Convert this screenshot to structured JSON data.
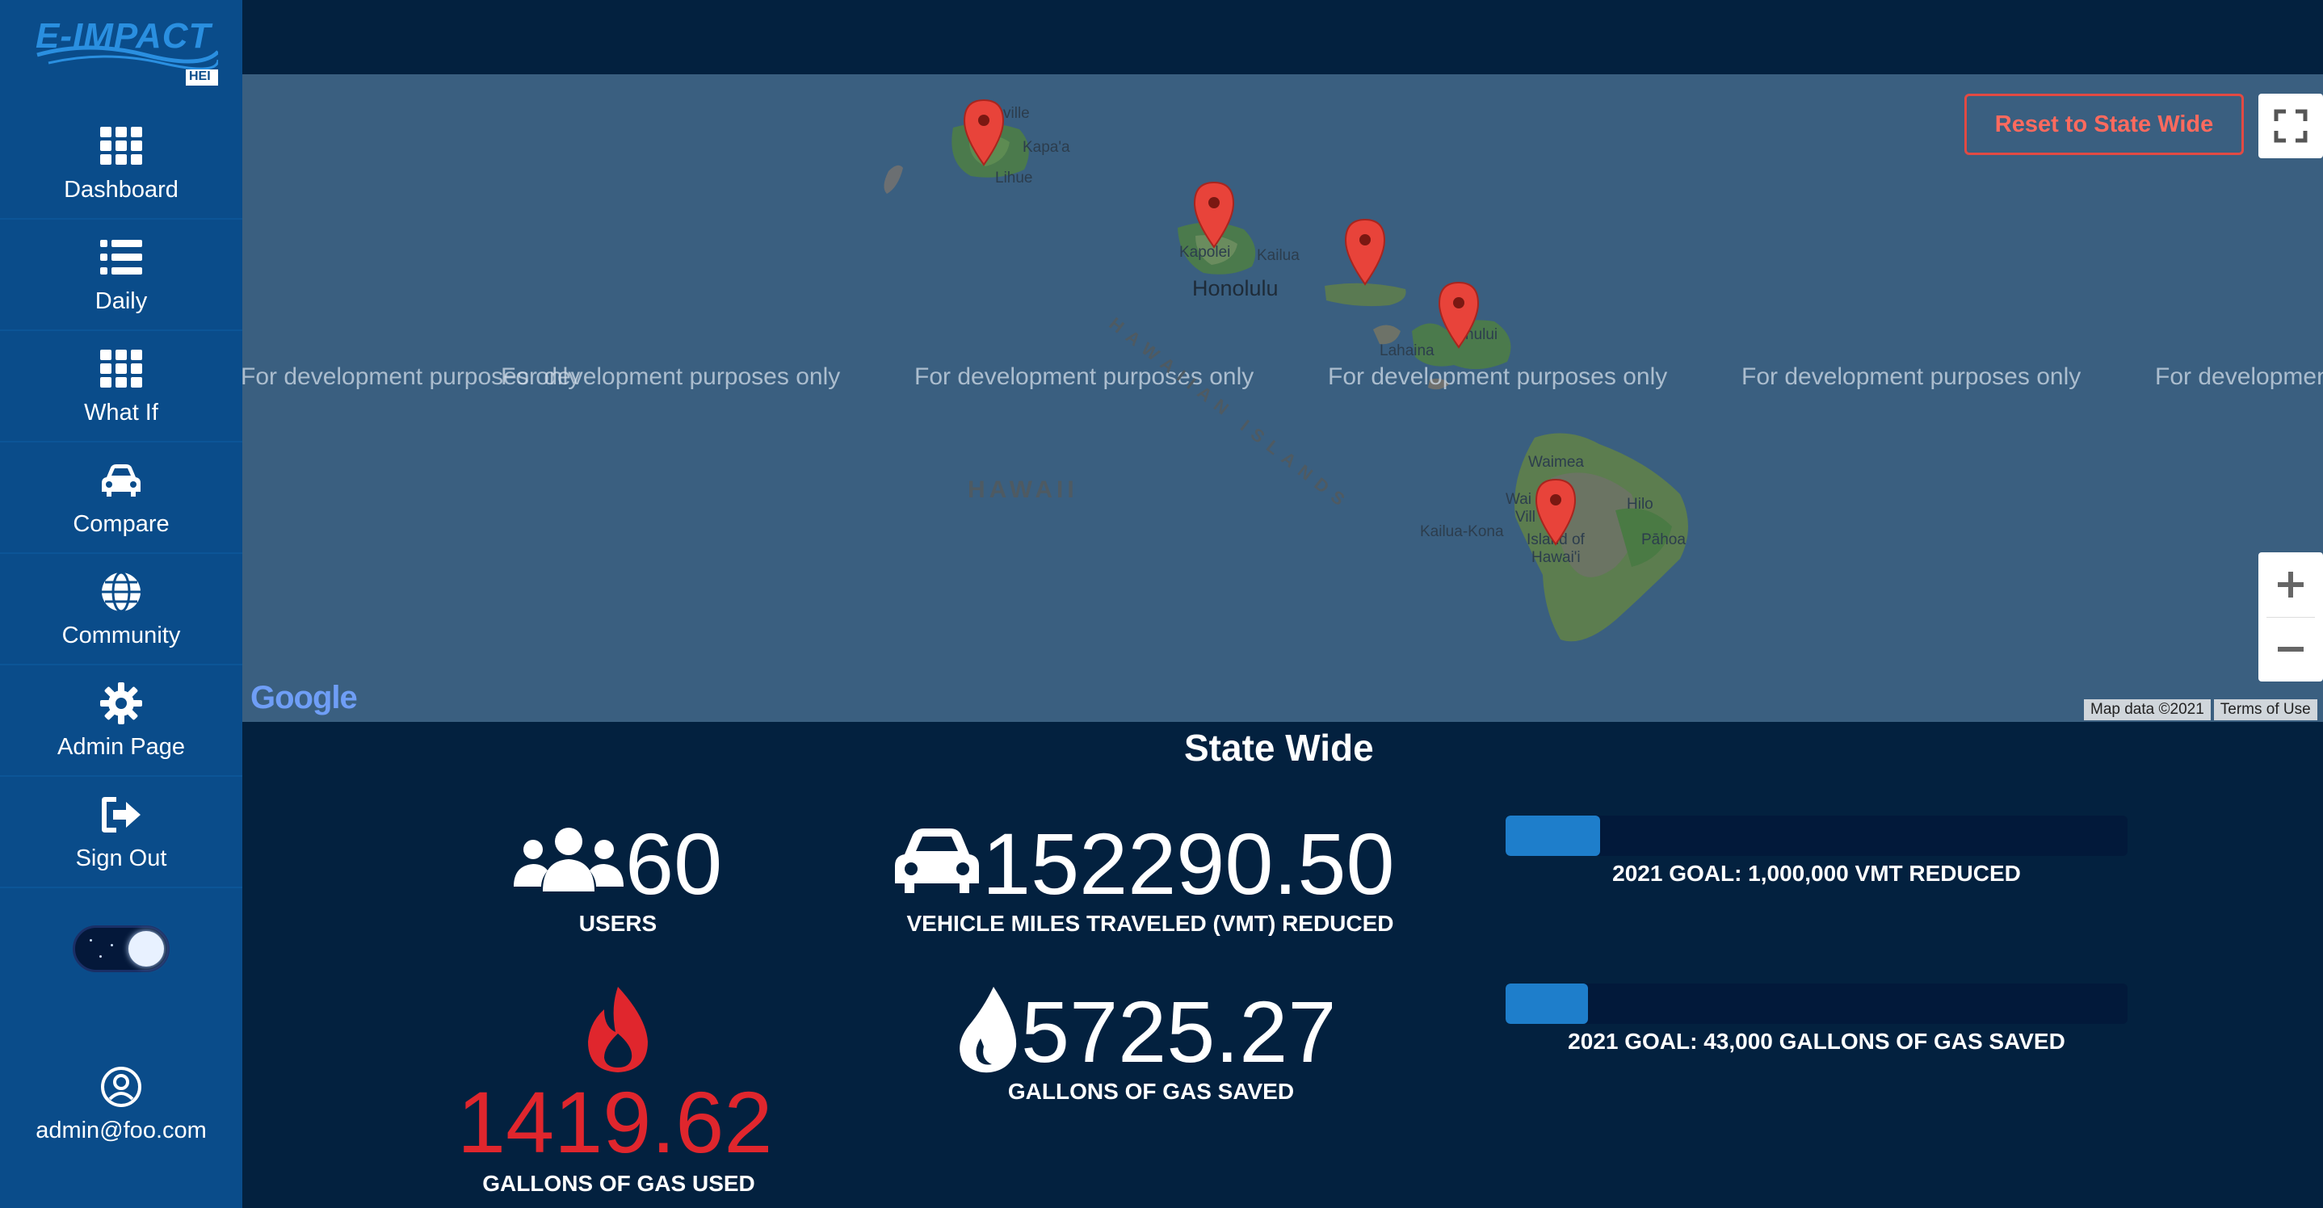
{
  "app": {
    "logo_text": "E-IMPACT",
    "logo_sub": "HEI"
  },
  "sidebar": {
    "items": [
      {
        "label": "Dashboard",
        "icon": "grid-icon"
      },
      {
        "label": "Daily",
        "icon": "list-icon"
      },
      {
        "label": "What If",
        "icon": "grid-icon"
      },
      {
        "label": "Compare",
        "icon": "car-icon"
      },
      {
        "label": "Community",
        "icon": "globe-icon"
      },
      {
        "label": "Admin Page",
        "icon": "gear-icon"
      },
      {
        "label": "Sign Out",
        "icon": "sign-out-icon"
      }
    ],
    "theme_toggle": "dark-mode",
    "user_email": "admin@foo.com"
  },
  "map": {
    "reset_button": "Reset to State Wide",
    "watermark": "For development purposes only",
    "region_labels": [
      "HAWAII",
      "HAWAIIAN ISLANDS"
    ],
    "place_labels": {
      "wailua": "ville",
      "kapaa": "Kapa'a",
      "lihue": "Lihue",
      "kapolei": "Kapolei",
      "kailua": "Kailua",
      "honolulu": "Honolulu",
      "kahului": "hului",
      "lahaina": "Lahaina",
      "waimea": "Waimea",
      "waikoloa": "Wai",
      "village": "Vill",
      "kona": "Kailua-Kona",
      "hilo": "Hilo",
      "pahoa": "Pāhoa",
      "island_hawaii": "Island of",
      "island_hawaii2": "Hawai'i"
    },
    "attribution": "Map data ©2021",
    "terms": "Terms of Use",
    "google": "Google",
    "pin_color": "#e8433a"
  },
  "stats": {
    "title": "State Wide",
    "users": {
      "value": "60",
      "label": "USERS"
    },
    "vmt": {
      "value": "152290.50",
      "label": "VEHICLE MILES TRAVELED (VMT) REDUCED"
    },
    "gas_used": {
      "value": "1419.62",
      "label": "GALLONS OF GAS USED",
      "color": "#e0262d"
    },
    "gas_saved": {
      "value": "5725.27",
      "label": "GALLONS OF GAS SAVED"
    },
    "goals": [
      {
        "label": "2021 GOAL: 1,000,000 VMT REDUCED",
        "progress": 0.152
      },
      {
        "label": "2021 GOAL: 43,000 GALLONS OF GAS SAVED",
        "progress": 0.133
      }
    ]
  }
}
